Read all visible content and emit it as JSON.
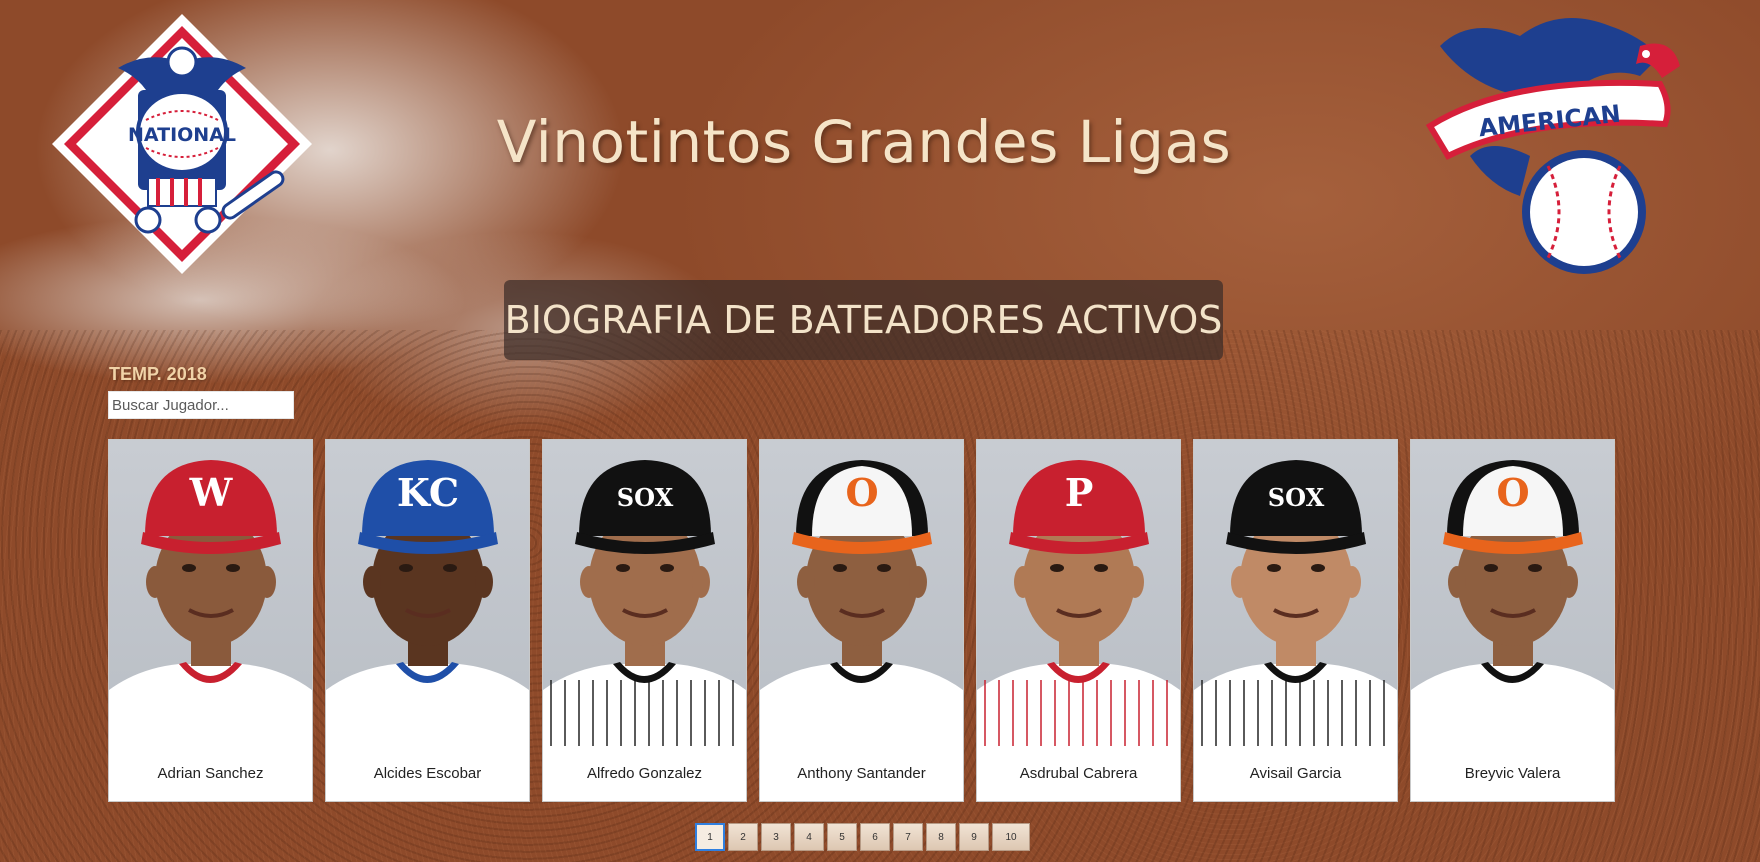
{
  "header": {
    "title": "Vinotintos Grandes Ligas",
    "subtitle": "BIOGRAFIA DE BATEADORES ACTIVOS",
    "left_logo": "national-league-logo",
    "left_logo_text": "NATIONAL",
    "right_logo": "american-league-logo",
    "right_logo_text": "AMERICAN"
  },
  "filter": {
    "season_label": "TEMP. 2018",
    "search_placeholder": "Buscar Jugador...",
    "search_value": ""
  },
  "players": [
    {
      "name": "Adrian Sanchez",
      "cap": "#c8202f",
      "cap_mark": "W",
      "mark_color": "#ffffff",
      "jersey": "#ffffff",
      "collar": "#c8202f",
      "stripes": false,
      "skin": "#8a5a3c"
    },
    {
      "name": "Alcides Escobar",
      "cap": "#1f4fa8",
      "cap_mark": "KC",
      "mark_color": "#ffffff",
      "jersey": "#ffffff",
      "collar": "#1f4fa8",
      "stripes": false,
      "skin": "#5a3520"
    },
    {
      "name": "Alfredo Gonzalez",
      "cap": "#111111",
      "cap_mark": "SOX",
      "mark_color": "#ffffff",
      "jersey": "#ffffff",
      "collar": "#111111",
      "stripes": true,
      "skin": "#a06d4c"
    },
    {
      "name": "Anthony Santander",
      "cap": "#f2f2f2",
      "cap_mark": "O",
      "mark_color": "#e8641c",
      "jersey": "#ffffff",
      "collar": "#111111",
      "stripes": false,
      "skin": "#8e5f40"
    },
    {
      "name": "Asdrubal Cabrera",
      "cap": "#c8202f",
      "cap_mark": "P",
      "mark_color": "#ffffff",
      "jersey": "#ffffff",
      "collar": "#c8202f",
      "stripes": true,
      "skin": "#b07a55"
    },
    {
      "name": "Avisail Garcia",
      "cap": "#111111",
      "cap_mark": "SOX",
      "mark_color": "#ffffff",
      "jersey": "#ffffff",
      "collar": "#111111",
      "stripes": true,
      "skin": "#c08a66"
    },
    {
      "name": "Breyvic Valera",
      "cap": "#f2f2f2",
      "cap_mark": "O",
      "mark_color": "#e8641c",
      "jersey": "#ffffff",
      "collar": "#111111",
      "stripes": false,
      "skin": "#8e5f40"
    }
  ],
  "pagination": {
    "pages": [
      "1",
      "2",
      "3",
      "4",
      "5",
      "6",
      "7",
      "8",
      "9",
      "10"
    ],
    "current": "1"
  },
  "colors": {
    "title": "#f5e4c8",
    "accent_blue": "#2f7fe0",
    "nl_red": "#d61f3a",
    "al_blue": "#1e3f8f"
  }
}
